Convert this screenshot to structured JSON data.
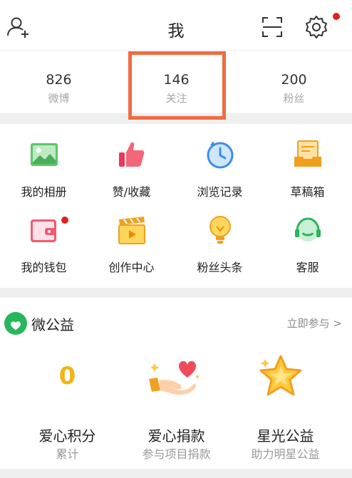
{
  "header": {
    "title": "我"
  },
  "stats": [
    {
      "count": "826",
      "label": "微博"
    },
    {
      "count": "146",
      "label": "关注"
    },
    {
      "count": "200",
      "label": "粉丝"
    }
  ],
  "menu": [
    {
      "label": "我的相册",
      "icon": "photo-album-icon"
    },
    {
      "label": "赞/收藏",
      "icon": "thumbs-up-icon"
    },
    {
      "label": "浏览记录",
      "icon": "clock-history-icon"
    },
    {
      "label": "草稿箱",
      "icon": "drafts-box-icon"
    },
    {
      "label": "我的钱包",
      "icon": "wallet-icon"
    },
    {
      "label": "创作中心",
      "icon": "clapperboard-icon"
    },
    {
      "label": "粉丝头条",
      "icon": "lightbulb-icon"
    },
    {
      "label": "客服",
      "icon": "headset-icon"
    }
  ],
  "charity": {
    "title": "微公益",
    "join_link": "立即参与 >",
    "items": [
      {
        "value": "0",
        "title": "爱心积分",
        "subtitle": "累计"
      },
      {
        "title": "爱心捐款",
        "subtitle": "参与项目捐款"
      },
      {
        "title": "星光公益",
        "subtitle": "助力明星公益"
      }
    ]
  },
  "colors": {
    "highlight": "#f06b3f",
    "badge": "#e02020",
    "charity_value": "#f4b417",
    "charity_logo": "#27b65c"
  }
}
